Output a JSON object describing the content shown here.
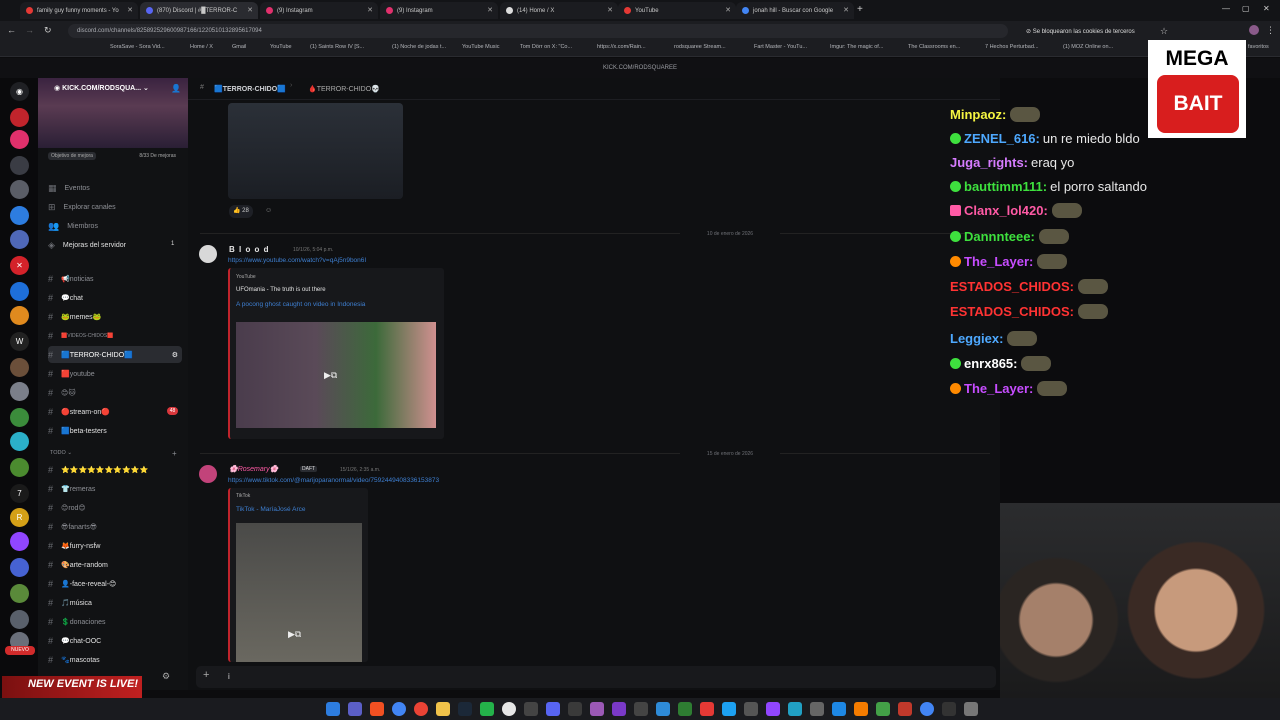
{
  "browser": {
    "tabs": [
      {
        "label": "family guy funny moments - Yo",
        "color": "#e53935"
      },
      {
        "label": "(870) Discord | #█TERROR-C",
        "color": "#5865f2"
      },
      {
        "label": "(9) Instagram",
        "color": "#e1306c"
      },
      {
        "label": "(9) Instagram",
        "color": "#e1306c"
      },
      {
        "label": "(14) Home / X",
        "color": "#dddddd"
      },
      {
        "label": "YouTube",
        "color": "#e53935"
      },
      {
        "label": "jonah hill - Buscar con Google",
        "color": "#4285f4"
      }
    ],
    "url": "discord.com/channels/825892529600987166/1220510132895617094",
    "third_party_notice": "Se bloquearon las cookies de terceros",
    "bookmarks": [
      "SoraSave - Sora Vid...",
      "Home / X",
      "Gmail",
      "YouTube",
      "(1) Saints Row IV [S...",
      "(1) Noche de jodas t...",
      "YouTube Music",
      "Tom Dörr on X: \"Co...",
      "https://x.com/Rain...",
      "rodsquaree Stream...",
      "Fart Master - YouTu...",
      "Imgur: The magic of...",
      "The Classrooms en...",
      "7 Hechos Perturbad...",
      "(1) MOZ Online on...",
      "favoritos"
    ],
    "page_title": "KICK.COM/RODSQUAREE"
  },
  "server": {
    "name": "KICK.COM/RODSQUA...",
    "boost_goal": "Objetivo de mejora",
    "boost_count": "8/33 De mejoras",
    "nav": [
      "Eventos",
      "Explorar canales",
      "Miembros",
      "Mejoras del servidor"
    ],
    "boost_badge": "1",
    "channels": [
      {
        "name": "📢noticias"
      },
      {
        "name": "💬chat"
      },
      {
        "name": "🐸memes🐸"
      },
      {
        "name": "🟥VIDEOS-CHIDOS🟥"
      },
      {
        "name": "🟦TERROR-CHIDO🟦",
        "selected": true
      },
      {
        "name": "🟥youtube"
      },
      {
        "name": "😊🐱"
      },
      {
        "name": "🔴stream-on🔴",
        "badge": "48"
      },
      {
        "name": "🟦beta-testers"
      }
    ],
    "category": "TODO",
    "channels2": [
      {
        "name": "⭐⭐⭐⭐⭐⭐⭐⭐⭐⭐"
      },
      {
        "name": "👕remeras"
      },
      {
        "name": "😊rod😊"
      },
      {
        "name": "😎fanarts😎"
      },
      {
        "name": "🦊furry-nsfw"
      },
      {
        "name": "🎨arte-random"
      },
      {
        "name": "👤-face-reveal-😊"
      },
      {
        "name": "🎵música"
      },
      {
        "name": "💲donaciones"
      },
      {
        "name": "💬chat-OOC"
      },
      {
        "name": "🐾mascotas"
      }
    ],
    "nuevo": "NUEVO",
    "event_banner": "NEW EVENT IS LIVE!"
  },
  "channel_header": {
    "channel": "🟦TERROR-CHIDO🟦",
    "thread": "🩸TERROR-CHIDO💀"
  },
  "messages": [
    {
      "reaction_count": "28"
    },
    {
      "date_sep": "10 de enero de 2026"
    },
    {
      "author": "B l o o d",
      "time": "10/1/26, 5:04 p.m.",
      "link": "https://www.youtube.com/watch?v=qAj5n9bon6I",
      "embed_provider": "YouTube",
      "embed_author": "UFOmania - The truth is out there",
      "embed_title": "A pocong ghost caught on video in Indonesia"
    },
    {
      "date_sep": "15 de enero de 2026"
    },
    {
      "author": "🌸Rosemary🌸",
      "tag": "DAFT",
      "time": "15/1/26, 2:35 a.m.",
      "link": "https://www.tiktok.com/@marijoparanormal/video/7592449408336153873",
      "embed_provider": "TikTok",
      "embed_title": "TikTok - MaríaJosé Arce"
    }
  ],
  "stream_chat": [
    {
      "user": "Minpaoz:",
      "color": "#f5f542",
      "msg": ""
    },
    {
      "user": "ZENEL_616:",
      "color": "#4ea9ff",
      "msg": "un re miedo bldo"
    },
    {
      "user": "Juga_rights:",
      "color": "#d67cff",
      "msg": "eraq yo"
    },
    {
      "user": "bauttimm111:",
      "color": "#3ee03e",
      "msg": "el porro saltando"
    },
    {
      "user": "Clanx_lol420:",
      "color": "#ff5aa5",
      "msg": ""
    },
    {
      "user": "Dannnteee:",
      "color": "#3ee03e",
      "msg": ""
    },
    {
      "user": "The_Layer:",
      "color": "#c74dff",
      "msg": ""
    },
    {
      "user": "ESTADOS_CHIDOS:",
      "color": "#ff3333",
      "msg": ""
    },
    {
      "user": "ESTADOS_CHIDOS:",
      "color": "#ff3333",
      "msg": ""
    },
    {
      "user": "Leggiex:",
      "color": "#4ea9ff",
      "msg": ""
    },
    {
      "user": "enrx865:",
      "color": "#ffffff",
      "msg": ""
    },
    {
      "user": "The_Layer:",
      "color": "#c74dff",
      "msg": ""
    }
  ],
  "overlay": {
    "mega": "MEGA",
    "bait": "BAIT"
  },
  "composer": {
    "value": "i"
  }
}
